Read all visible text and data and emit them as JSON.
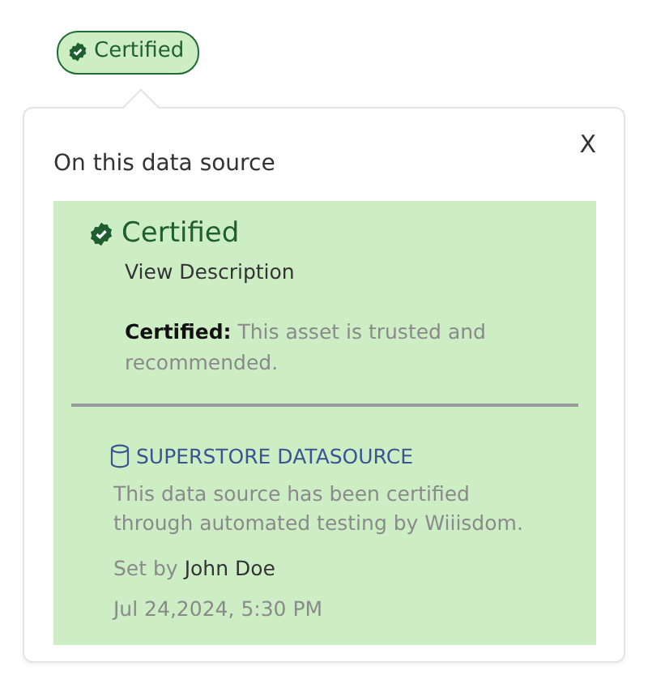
{
  "badge": {
    "label": "Certified"
  },
  "popover": {
    "title": "On this data source",
    "close": "X",
    "status": {
      "label": "Certified",
      "link": "View Description",
      "description": "**Certified:** This asset is trusted and recommended."
    },
    "datasource": {
      "name": "SUPERSTORE DATASOURCE",
      "note": "This data source has been certified through automated testing by Wiiisdom.",
      "set_by": "Set by **John Doe**",
      "date": "Jul 24,2024, 5:30 PM"
    }
  }
}
